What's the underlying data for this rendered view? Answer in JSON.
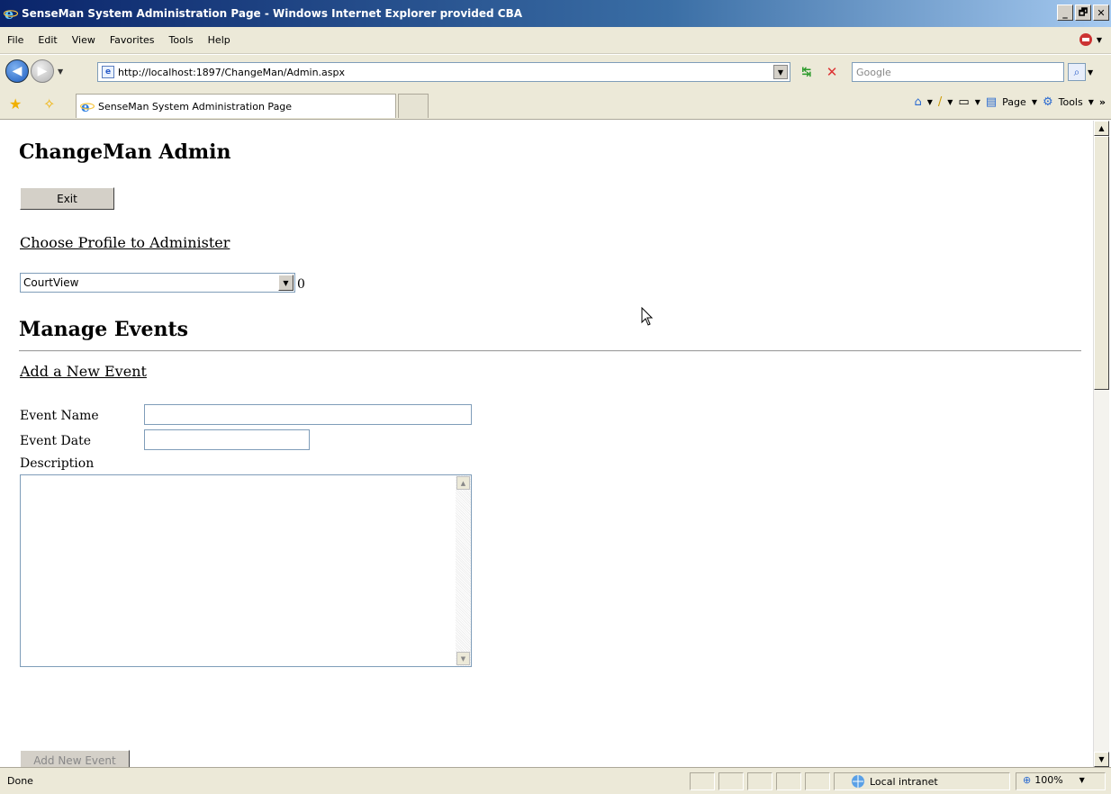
{
  "window": {
    "title": "SenseMan System Administration Page - Windows Internet Explorer provided CBA",
    "buttons": [
      "_",
      "🗗",
      "✕"
    ]
  },
  "menubar": {
    "items": [
      "File",
      "Edit",
      "View",
      "Favorites",
      "Tools",
      "Help"
    ]
  },
  "addressbar": {
    "url": "http://localhost:1897/ChangeMan/Admin.aspx",
    "search_placeholder": "Google"
  },
  "tabbar": {
    "active_tab": "SenseMan System Administration Page",
    "page_label": "Page",
    "tools_label": "Tools",
    "chevron": "»"
  },
  "page": {
    "title": "ChangeMan Admin",
    "exit_label": "Exit",
    "choose_profile_link": "Choose Profile to Administer",
    "profile_selected": "CourtView",
    "profile_count": "0",
    "manage_events_heading": "Manage Events",
    "add_event_link": "Add a New Event",
    "event_name_label": "Event Name",
    "event_name_value": "",
    "event_date_label": "Event Date",
    "event_date_value": "",
    "description_label": "Description",
    "description_value": "",
    "add_event_button": "Add New Event"
  },
  "statusbar": {
    "status": "Done",
    "zone": "Local intranet",
    "zoom": "100%"
  },
  "colors": {
    "title_gradient_start": "#0a246a",
    "chrome": "#ece9d8",
    "button_face": "#d4d0c8"
  }
}
